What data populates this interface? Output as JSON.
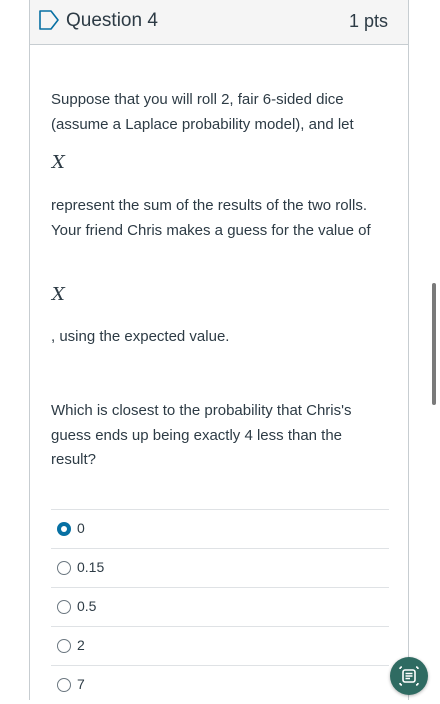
{
  "question": {
    "title": "Question 4",
    "points": "1 pts",
    "text_1": "Suppose that you will roll 2, fair 6-sided dice (assume a Laplace probability model), and let",
    "math_1": "X",
    "text_2": "represent the sum of the results of the two rolls. Your friend Chris makes a guess for the value of",
    "math_2": "X",
    "text_3": ", using the expected value.",
    "prompt": "Which is closest to the probability that Chris's guess ends up being exactly 4 less than the result?"
  },
  "answers": [
    {
      "label": "0",
      "selected": true
    },
    {
      "label": "0.15",
      "selected": false
    },
    {
      "label": "0.5",
      "selected": false
    },
    {
      "label": "2",
      "selected": false
    },
    {
      "label": "7",
      "selected": false
    }
  ],
  "colors": {
    "accent": "#0770a3",
    "header_bg": "#f5f5f5",
    "text": "#2d3b45",
    "fab": "#2f6b62"
  },
  "icons": {
    "flag": "flag-icon",
    "fab": "text-reader-icon"
  }
}
